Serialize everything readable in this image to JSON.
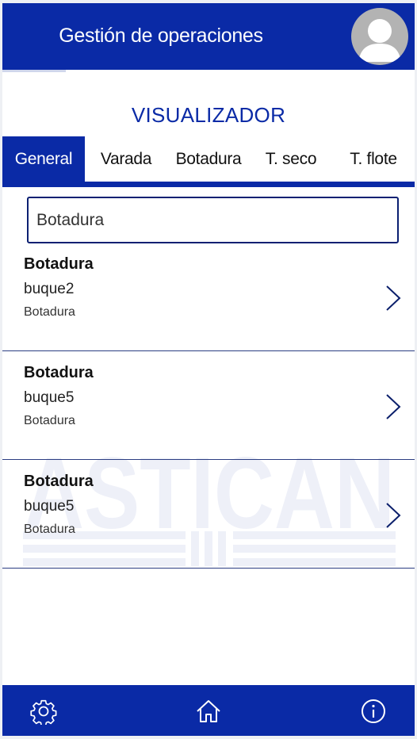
{
  "header": {
    "title": "Gestión de operaciones",
    "avatar_icon": "user-avatar-icon"
  },
  "section_title": "VISUALIZADOR",
  "tabs": [
    {
      "label": "General",
      "active": true
    },
    {
      "label": "Varada",
      "active": false
    },
    {
      "label": "Botadura",
      "active": false
    },
    {
      "label": "T. seco",
      "active": false
    },
    {
      "label": "T. flote",
      "active": false
    }
  ],
  "search": {
    "value": "Botadura"
  },
  "watermark": {
    "text": "ASTICAN"
  },
  "list": [
    {
      "title": "Botadura",
      "subtitle": "buque2",
      "meta": "Botadura"
    },
    {
      "title": "Botadura",
      "subtitle": "buque5",
      "meta": "Botadura"
    },
    {
      "title": "Botadura",
      "subtitle": "buque5",
      "meta": "Botadura"
    }
  ],
  "footer": {
    "icons": [
      "settings-icon",
      "home-icon",
      "info-icon"
    ]
  },
  "colors": {
    "primary": "#0a2aa6",
    "divider": "#2b3d82",
    "avatar": "#b3b3b3"
  }
}
